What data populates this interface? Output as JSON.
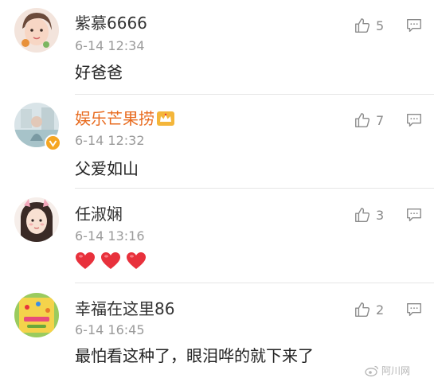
{
  "comments": [
    {
      "username": "紫慕6666",
      "time": "6-14 12:34",
      "text": "好爸爸",
      "likes": "5",
      "verified": false,
      "crown": false
    },
    {
      "username": "娱乐芒果捞",
      "time": "6-14 12:32",
      "text": "父爱如山",
      "likes": "7",
      "verified": true,
      "crown": true
    },
    {
      "username": "任淑娴",
      "time": "6-14 13:16",
      "text": "",
      "emoji": [
        "❤",
        "❤",
        "❤"
      ],
      "likes": "3",
      "verified": false,
      "crown": false
    },
    {
      "username": "幸福在这里86",
      "time": "6-14 16:45",
      "text": "最怕看这种了，眼泪哗的就下来了",
      "likes": "2",
      "verified": false,
      "crown": false
    }
  ],
  "watermark": {
    "text": "阿川网"
  },
  "icons": {
    "like": "thumbs-up-icon",
    "reply": "comment-bubble-icon",
    "crown": "crown-icon",
    "verified": "verified-badge-icon",
    "weibo": "weibo-logo-icon"
  },
  "colors": {
    "vip_name": "#e86b1f",
    "name": "#333333",
    "time": "#9a9a9a",
    "heart": "#e8313c",
    "verified": "#f5a623"
  }
}
